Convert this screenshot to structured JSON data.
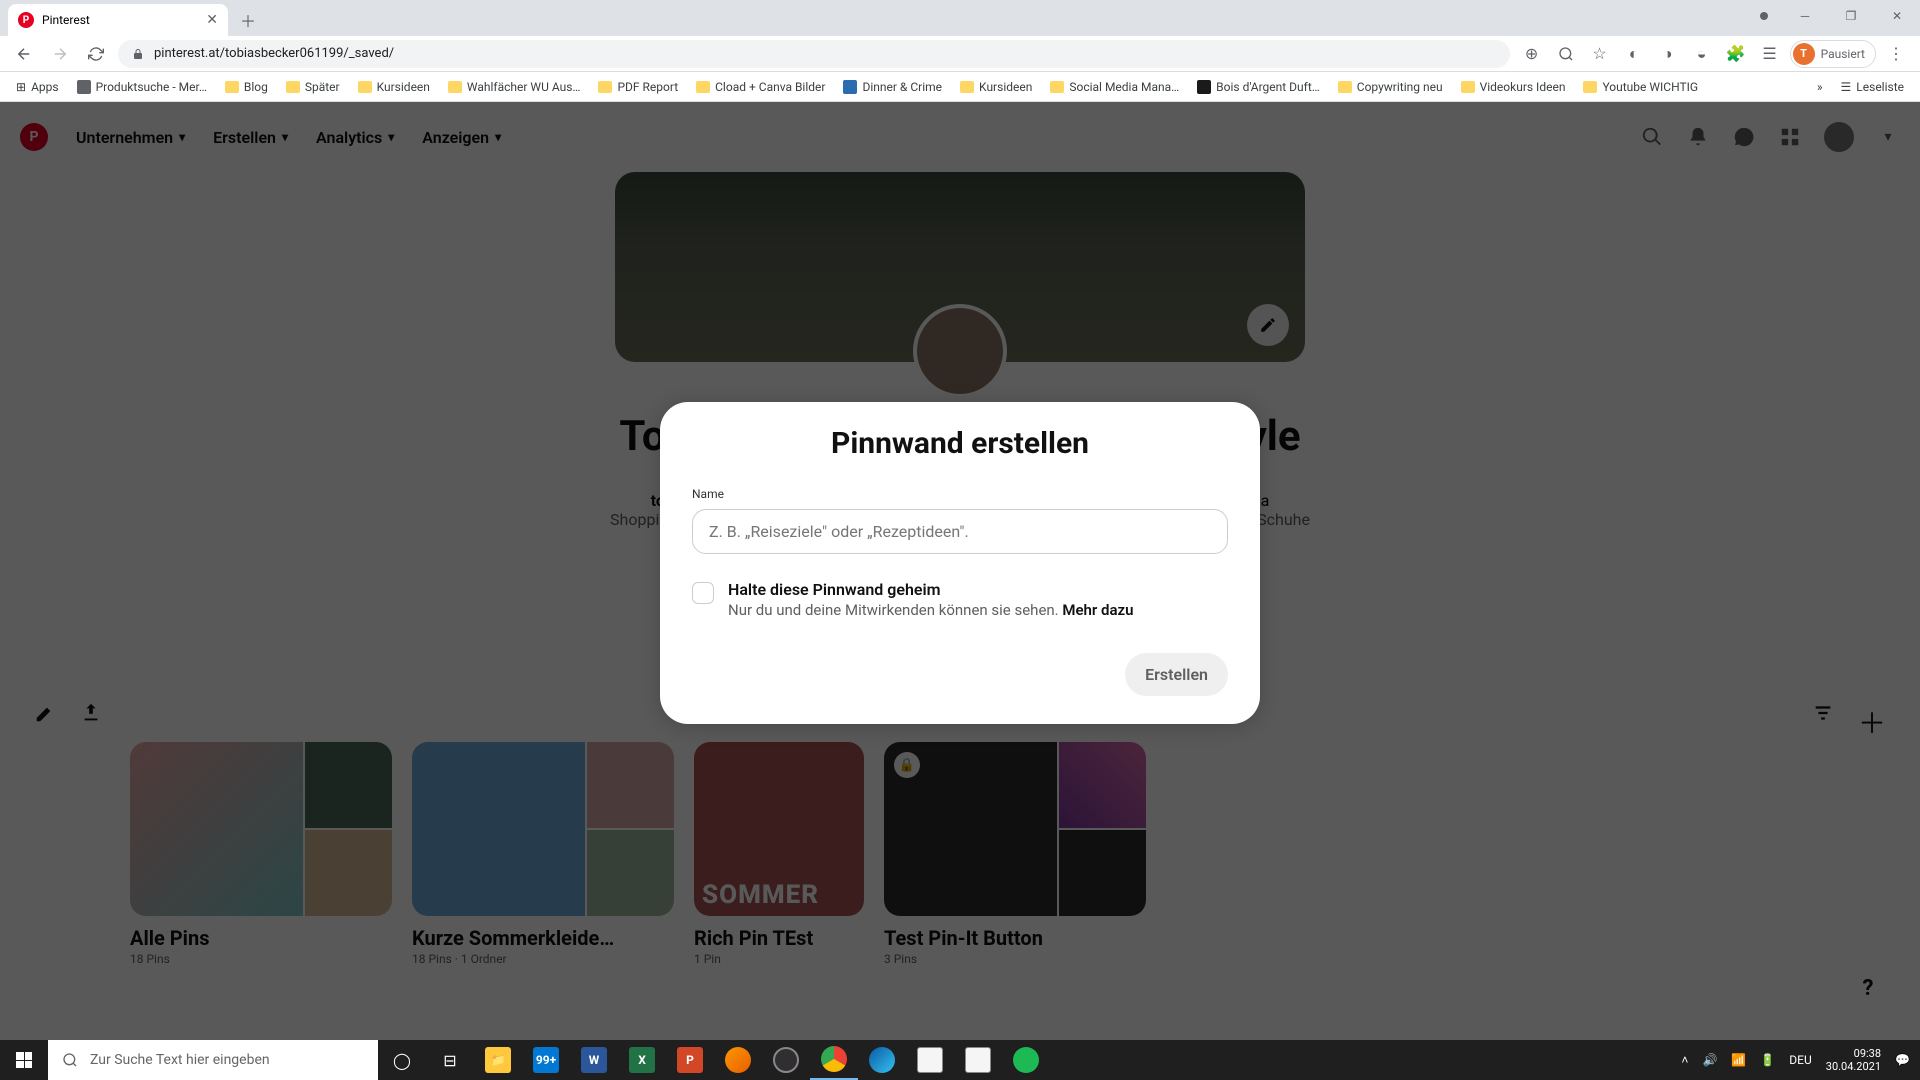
{
  "browser": {
    "tab_title": "Pinterest",
    "url": "pinterest.at/tobiasbecker061199/_saved/",
    "pausiert_label": "Pausiert",
    "pausiert_initial": "T",
    "apps_label": "Apps"
  },
  "bookmarks": [
    {
      "label": "Produktsuche - Mer…",
      "type": "icon"
    },
    {
      "label": "Blog",
      "type": "folder"
    },
    {
      "label": "Später",
      "type": "folder"
    },
    {
      "label": "Kursideen",
      "type": "folder"
    },
    {
      "label": "Wahlfächer WU Aus…",
      "type": "folder"
    },
    {
      "label": "PDF Report",
      "type": "folder"
    },
    {
      "label": "Cload + Canva Bilder",
      "type": "folder"
    },
    {
      "label": "Dinner & Crime",
      "type": "icon"
    },
    {
      "label": "Kursideen",
      "type": "folder"
    },
    {
      "label": "Social Media Mana…",
      "type": "folder"
    },
    {
      "label": "Bois d'Argent Duft…",
      "type": "icon"
    },
    {
      "label": "Copywriting neu",
      "type": "folder"
    },
    {
      "label": "Videokurs Ideen",
      "type": "folder"
    },
    {
      "label": "Youtube WICHTIG",
      "type": "folder"
    }
  ],
  "bookmarks_right": {
    "label": "Leseliste"
  },
  "pin_nav": {
    "item1": "Unternehmen",
    "item2": "Erstellen",
    "item3": "Analytics",
    "item4": "Anzeigen"
  },
  "profile": {
    "name_left": "To",
    "name_right": "yle",
    "desc1_left": "tobi",
    "desc1_right": "ema",
    "desc2_left": "Shopping",
    "desc2_right": "Schuhe"
  },
  "boards": [
    {
      "title": "Alle Pins",
      "meta": "18 Pins"
    },
    {
      "title": "Kurze Sommerkleide…",
      "meta": "18 Pins · 1 Ordner"
    },
    {
      "title": "Rich Pin TEst",
      "meta": "1 Pin"
    },
    {
      "title": "Test Pin-It Button",
      "meta": "3 Pins"
    }
  ],
  "modal": {
    "title": "Pinnwand erstellen",
    "label": "Name",
    "placeholder": "Z. B. „Reiseziele\" oder „Rezeptideen\".",
    "check_label": "Halte diese Pinnwand geheim",
    "check_sub_text": "Nur du und deine Mitwirkenden können sie sehen. ",
    "check_sub_link": "Mehr dazu",
    "submit": "Erstellen"
  },
  "taskbar": {
    "search_placeholder": "Zur Suche Text hier eingeben",
    "lang": "DEU",
    "time": "09:38",
    "date": "30.04.2021"
  }
}
